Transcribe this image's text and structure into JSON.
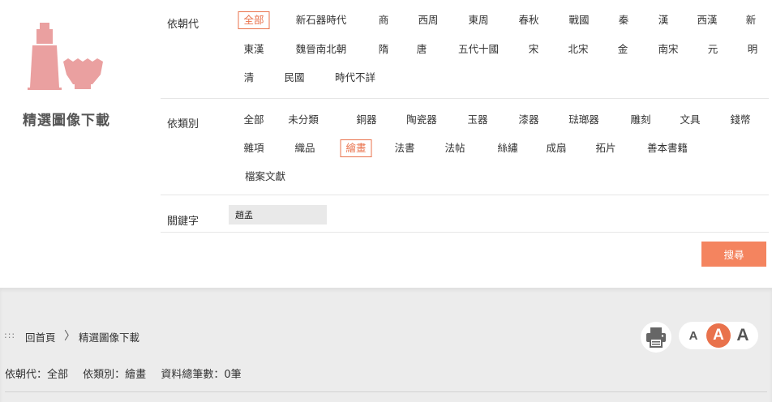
{
  "section": {
    "title": "精選圖像下載"
  },
  "dynasty": {
    "label": "依朝代",
    "options": [
      [
        "全部",
        "新石器時代",
        "商",
        "西周",
        "東周",
        "春秋",
        "戰國",
        "秦",
        "漢",
        "西漢",
        "新"
      ],
      [
        "東漢",
        "魏晉南北朝",
        "隋",
        "唐",
        "五代十國",
        "宋",
        "北宋",
        "金",
        "南宋",
        "元",
        "明"
      ],
      [
        "清",
        "民國",
        "時代不詳"
      ]
    ],
    "selected": "全部"
  },
  "category": {
    "label": "依類別",
    "options": [
      [
        "全部",
        "未分類",
        "銅器",
        "陶瓷器",
        "玉器",
        "漆器",
        "琺瑯器",
        "雕刻",
        "文具",
        "錢幣"
      ],
      [
        "雜項",
        "織品",
        "繪畫",
        "法書",
        "法帖",
        "絲繡",
        "成扇",
        "拓片",
        "善本書籍"
      ],
      [
        "檔案文獻"
      ]
    ],
    "selected": "繪畫"
  },
  "keyword": {
    "label": "關鍵字",
    "value": "趙孟"
  },
  "search_button": {
    "label": "搜尋"
  },
  "breadcrumb": {
    "dots": ":::",
    "home": "回首頁",
    "sep": "〉",
    "current": "精選圖像下載"
  },
  "font_size": {
    "small": "A",
    "mid": "A",
    "large": "A"
  },
  "result": {
    "dynasty": "依朝代：全部",
    "category": "依類別：繪畫",
    "count": "資料總筆數：0筆"
  },
  "colors": {
    "accent": "#e9724c",
    "button": "#f4845f",
    "logo": "#eaa0a0"
  }
}
